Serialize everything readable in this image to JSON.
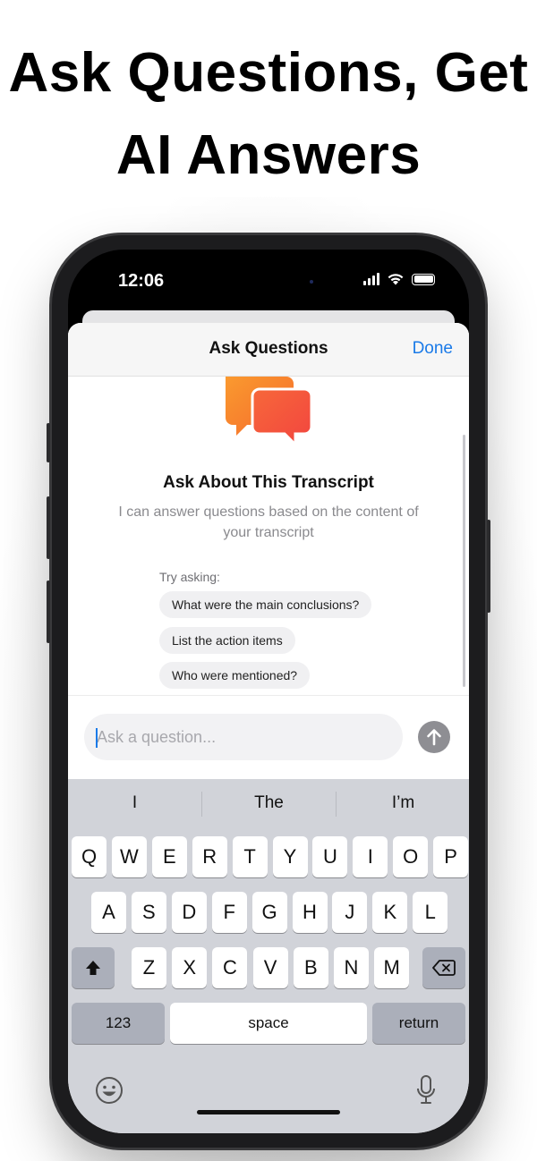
{
  "headline": {
    "line1": "Ask Questions, Get",
    "line2": "AI Answers"
  },
  "status_bar": {
    "time": "12:06"
  },
  "sheet": {
    "title": "Ask Questions",
    "done_label": "Done",
    "about_title": "Ask About This Transcript",
    "about_subtitle": "I can answer questions based on the content of your transcript",
    "try_label": "Try asking:",
    "suggestions": [
      "What were the main conclusions?",
      "List the action items",
      "Who were mentioned?"
    ],
    "input_placeholder": "Ask a question..."
  },
  "keyboard": {
    "predictions": [
      "I",
      "The",
      "I’m"
    ],
    "row1": [
      "Q",
      "W",
      "E",
      "R",
      "T",
      "Y",
      "U",
      "I",
      "O",
      "P"
    ],
    "row2": [
      "A",
      "S",
      "D",
      "F",
      "G",
      "H",
      "J",
      "K",
      "L"
    ],
    "row3": [
      "Z",
      "X",
      "C",
      "V",
      "B",
      "N",
      "M"
    ],
    "numbers_label": "123",
    "space_label": "space",
    "return_label": "return"
  },
  "colors": {
    "accent": "#1a7ae8",
    "icon_orange": "#f7812c",
    "icon_red": "#f4513c"
  },
  "icons": [
    "chat-bubbles-icon",
    "send-arrow-icon",
    "shift-icon",
    "backspace-icon",
    "emoji-icon",
    "microphone-icon"
  ]
}
